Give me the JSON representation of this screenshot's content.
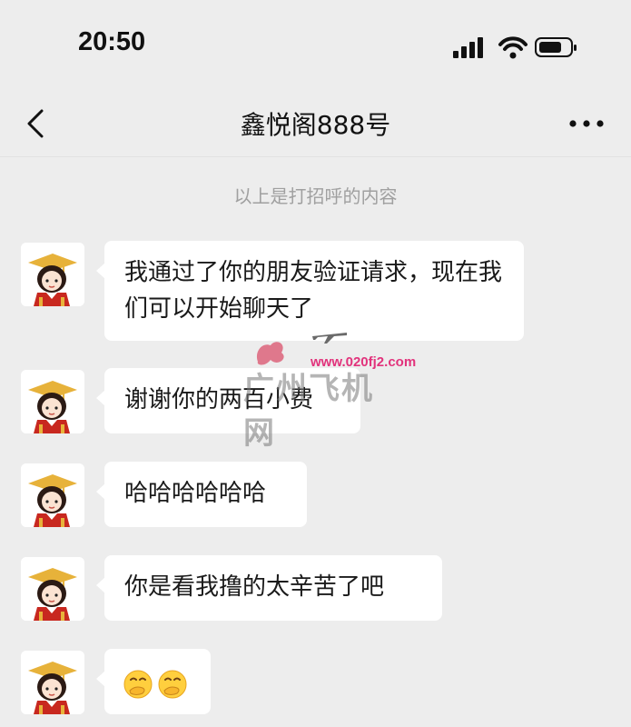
{
  "status_bar": {
    "time": "20:50",
    "icons": [
      "signal-icon",
      "wifi-icon",
      "battery-icon"
    ]
  },
  "nav": {
    "title": "鑫悦阁888号",
    "back_icon": "chevron-left-icon",
    "more_icon": "more-horizontal-icon"
  },
  "system_note": "以上是打招呼的内容",
  "messages": [
    {
      "text": "我通过了你的朋友验证请求，现在我们可以开始聊天了"
    },
    {
      "text": "谢谢你的两百小费"
    },
    {
      "text": "哈哈哈哈哈哈"
    },
    {
      "text": "你是看我撸的太辛苦了吧"
    },
    {
      "emoji": [
        "hand-over-mouth-emoji",
        "hand-over-mouth-emoji"
      ]
    }
  ],
  "watermark": {
    "url": "www.020fj2.com",
    "name": "广州飞机网"
  },
  "colors": {
    "background": "#ededed",
    "bubble": "#ffffff",
    "watermark_url": "#e2337c"
  }
}
